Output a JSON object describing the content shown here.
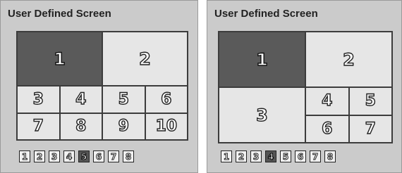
{
  "left_screen": {
    "title": "User Defined Screen",
    "cells": [
      "1",
      "2",
      "3",
      "4",
      "5",
      "6",
      "7",
      "8",
      "9",
      "10"
    ],
    "selected_cell": "1",
    "buttons": [
      "1",
      "2",
      "3",
      "4",
      "5",
      "6",
      "7",
      "8"
    ],
    "selected_button": "5"
  },
  "right_screen": {
    "title": "User Defined Screen",
    "cells": [
      "1",
      "2",
      "3",
      "4",
      "5",
      "6",
      "7"
    ],
    "selected_cell": "1",
    "buttons": [
      "1",
      "2",
      "3",
      "4",
      "5",
      "6",
      "7",
      "8"
    ],
    "selected_button": "4"
  },
  "colors": {
    "panel_bg": "#cbcbcb",
    "cell_bg": "#e6e6e6",
    "selected_cell_bg": "#5a5a5a",
    "grid_line": "#3c3c3c"
  }
}
